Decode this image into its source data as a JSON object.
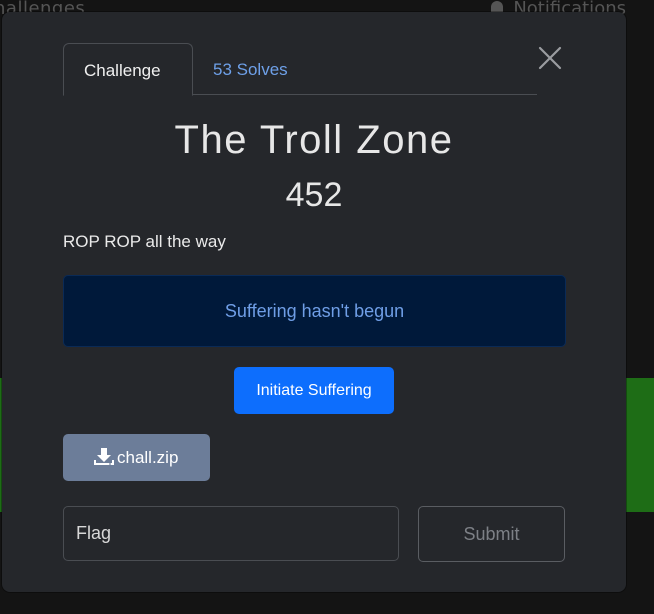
{
  "background": {
    "nav_left_text": "hallenges",
    "nav_right_text": "Notifications"
  },
  "modal": {
    "tabs": [
      {
        "label": "Challenge",
        "active": true
      },
      {
        "label": "53 Solves",
        "active": false
      }
    ],
    "title": "The Troll Zone",
    "points": "452",
    "description": "ROP ROP all the way",
    "status_message": "Suffering hasn't begun",
    "initiate_button": "Initiate Suffering",
    "download": {
      "label": "chall.zip",
      "icon": "download-icon"
    },
    "flag_input": {
      "placeholder": "Flag",
      "value": ""
    },
    "submit_button": "Submit",
    "close_icon": "close-icon"
  },
  "colors": {
    "modal_bg": "#25272b",
    "primary": "#0d6efd",
    "status_bg": "#00193a",
    "status_text": "#6f9ee6",
    "secondary": "#6c7d99",
    "accent_green": "#1e6d16"
  }
}
